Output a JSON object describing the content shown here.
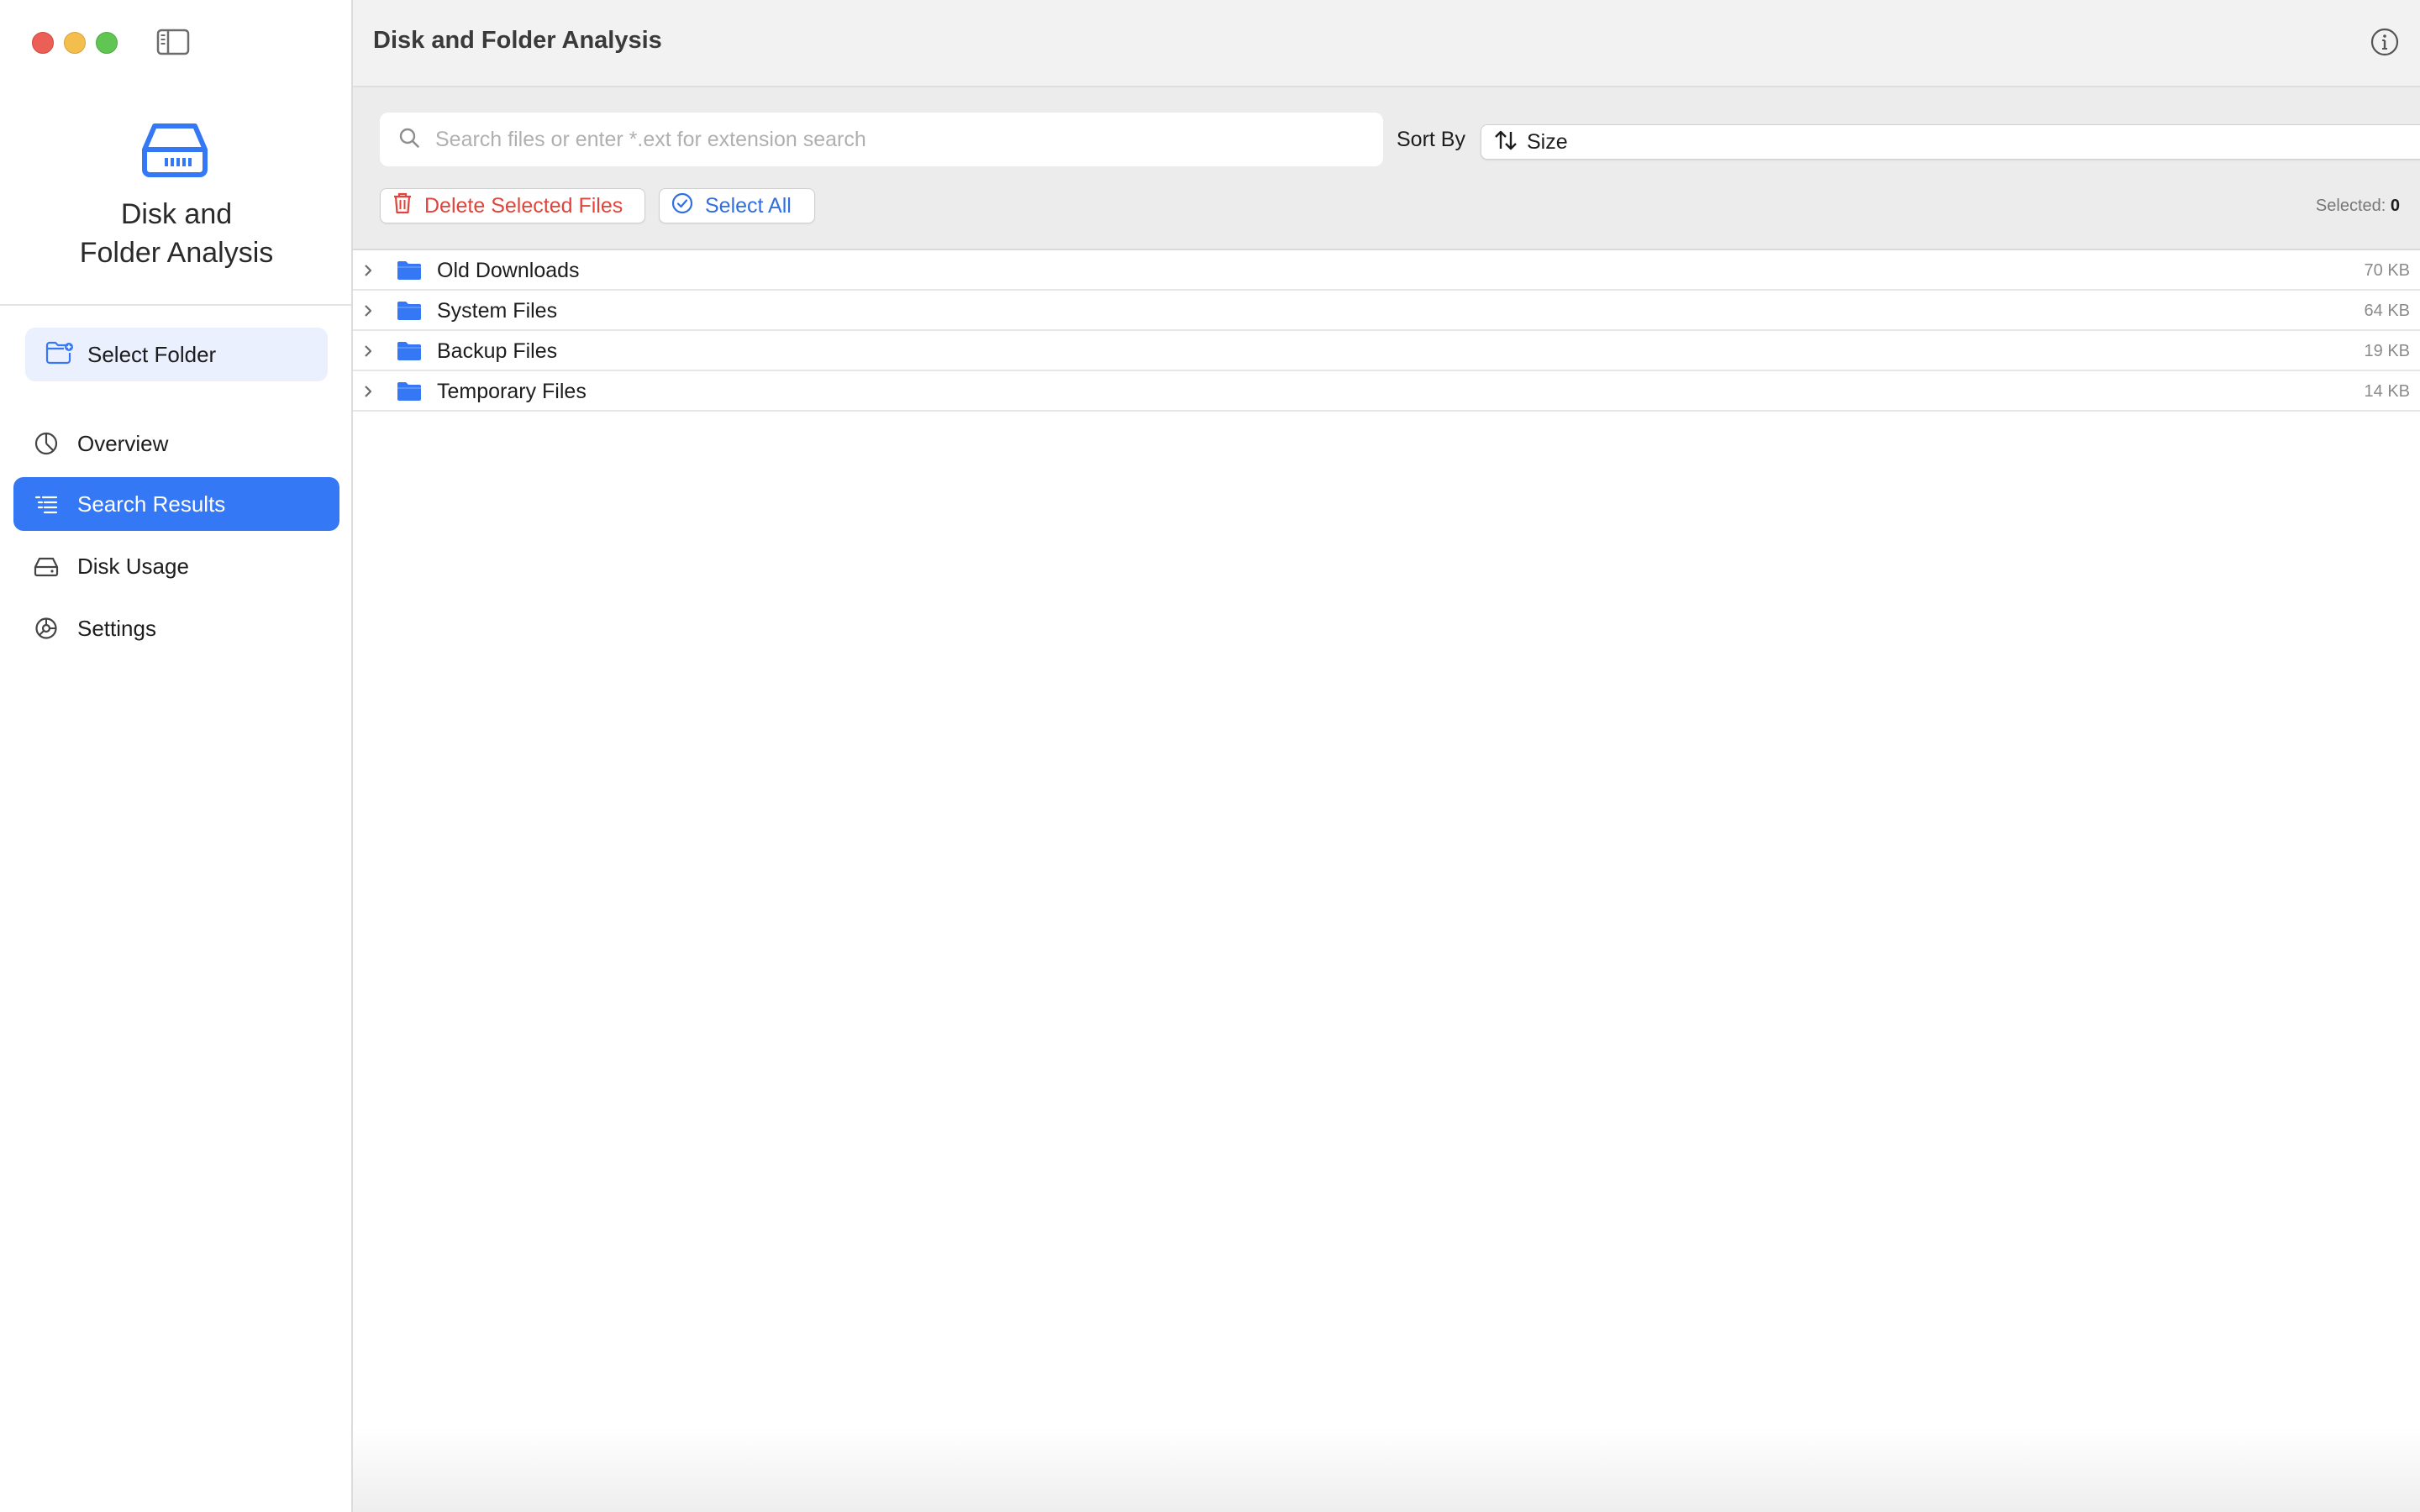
{
  "app": {
    "title_line1": "Disk and",
    "title_line2": "Folder Analysis",
    "window_title": "Disk and Folder Analysis",
    "accent_color": "#3478f6"
  },
  "sidebar": {
    "select_folder_label": "Select Folder",
    "items": [
      {
        "label": "Overview",
        "icon": "chart-pie-icon",
        "active": false
      },
      {
        "label": "Search Results",
        "icon": "list-icon",
        "active": true
      },
      {
        "label": "Disk Usage",
        "icon": "drive-icon",
        "active": false
      },
      {
        "label": "Settings",
        "icon": "gear-icon",
        "active": false
      }
    ]
  },
  "toolbar": {
    "search_placeholder": "Search files or enter *.ext for extension search",
    "search_value": "",
    "sort_label": "Sort By",
    "sort_value": "Size",
    "delete_label": "Delete Selected Files",
    "select_all_label": "Select All",
    "selected_label": "Selected:",
    "selected_count": "0"
  },
  "files": [
    {
      "name": "Old Downloads",
      "size": "70 KB"
    },
    {
      "name": "System Files",
      "size": "64 KB"
    },
    {
      "name": "Backup Files",
      "size": "19 KB"
    },
    {
      "name": "Temporary Files",
      "size": "14 KB"
    }
  ]
}
